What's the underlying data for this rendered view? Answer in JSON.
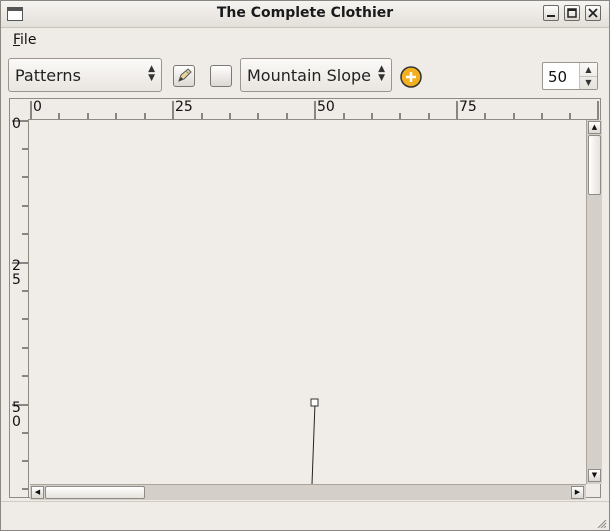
{
  "window": {
    "title": "The Complete Clothier"
  },
  "menubar": {
    "file_label": "File",
    "file_mnemonic": "F",
    "file_rest": "ile"
  },
  "toolbar": {
    "category_combo": {
      "selected": "Patterns"
    },
    "pencil_tool_icon": "pencil-icon",
    "select_tool_icon": "rectangle-icon",
    "pattern_combo": {
      "selected": "Mountain Slope"
    },
    "add_icon": "add-circle-icon",
    "zoom_spin": {
      "value": "50"
    }
  },
  "rulers": {
    "horizontal_labels": [
      "0",
      "25",
      "50",
      "75"
    ],
    "vertical_labels": [
      [
        "0"
      ],
      [
        "2",
        "5"
      ],
      [
        "5",
        "0"
      ]
    ]
  },
  "colors": {
    "window_bg": "#efebe7",
    "canvas_bg": "#f0ede8",
    "add_icon": "#f2b01e"
  }
}
